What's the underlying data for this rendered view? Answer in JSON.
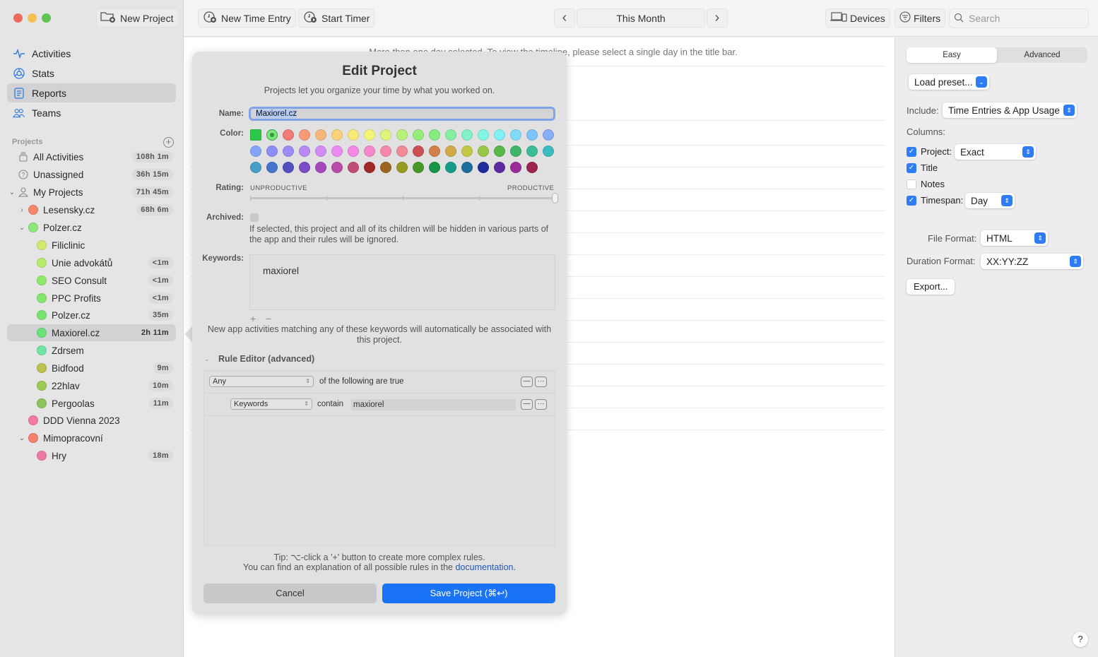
{
  "window": {
    "new_project_label": "New Project"
  },
  "sidebar": {
    "nav": [
      {
        "label": "Activities",
        "icon": "activity-pulse-icon"
      },
      {
        "label": "Stats",
        "icon": "stats-icon"
      },
      {
        "label": "Reports",
        "icon": "report-icon",
        "active": true
      },
      {
        "label": "Teams",
        "icon": "teams-icon"
      }
    ],
    "projects_header": "Projects",
    "add_project_icon": "+",
    "projects": [
      {
        "label": "All Activities",
        "badge": "108h 1m"
      },
      {
        "label": "Unassigned",
        "badge": "36h 15m"
      },
      {
        "label": "My Projects",
        "badge": "71h 45m"
      },
      {
        "label": "Lesensky.cz",
        "badge": "68h 6m",
        "color": "#f5876a"
      },
      {
        "label": "Polzer.cz",
        "badge": "",
        "color": "#8de87a"
      },
      {
        "label": "Filiclinic",
        "badge": "",
        "color": "#d2ea6e"
      },
      {
        "label": "Unie advokátů",
        "badge": "<1m",
        "color": "#b6ec6c"
      },
      {
        "label": "SEO Consult",
        "badge": "<1m",
        "color": "#8eea6a"
      },
      {
        "label": "PPC Profits",
        "badge": "<1m",
        "color": "#84e66e"
      },
      {
        "label": "Polzer.cz",
        "badge": "35m",
        "color": "#78e470"
      },
      {
        "label": "Maxiorel.cz",
        "badge": "2h 11m",
        "color": "#6be27a"
      },
      {
        "label": "Zdrsem",
        "badge": "",
        "color": "#6ee6a2"
      },
      {
        "label": "Bidfood",
        "badge": "9m",
        "color": "#bcc24c"
      },
      {
        "label": "22hlav",
        "badge": "10m",
        "color": "#9ccc52"
      },
      {
        "label": "Pergoolas",
        "badge": "11m",
        "color": "#8dc45e"
      },
      {
        "label": "DDD Vienna 2023",
        "badge": "",
        "color": "#f47aa4"
      },
      {
        "label": "Mimopracovní",
        "badge": "",
        "color": "#f5806e"
      },
      {
        "label": "Hry",
        "badge": "18m",
        "color": "#ee78a6"
      }
    ]
  },
  "toolbar": {
    "new_time_entry": "New Time Entry",
    "start_timer": "Start Timer",
    "period": "This Month",
    "prev_icon": "‹",
    "next_icon": "›",
    "devices": "Devices",
    "filters": "Filters",
    "search_placeholder": "Search"
  },
  "main": {
    "message": "More than one day selected. To view the timeline, please select a single day in the title bar."
  },
  "right_panel": {
    "tabs": [
      "Easy",
      "Advanced"
    ],
    "active_tab": "Easy",
    "load_preset": "Load preset...",
    "include_label": "Include:",
    "include_value": "Time Entries & App Usage",
    "columns_label": "Columns:",
    "columns": [
      {
        "label": "Project:",
        "checked": true,
        "select": "Exact"
      },
      {
        "label": "Title",
        "checked": true
      },
      {
        "label": "Notes",
        "checked": false
      },
      {
        "label": "Timespan:",
        "checked": true,
        "select": "Day"
      }
    ],
    "file_format_label": "File Format:",
    "file_format_value": "HTML",
    "duration_format_label": "Duration Format:",
    "duration_format_value": "XX:YY:ZZ",
    "export_label": "Export...",
    "help_label": "?"
  },
  "dialog": {
    "title": "Edit Project",
    "subtitle": "Projects let you organize your time by what you worked on.",
    "name_label": "Name:",
    "name_value": "Maxiorel.cz",
    "color_label": "Color:",
    "colors": [
      [
        "#2bc94a",
        "#7ee57b",
        "#f47a76",
        "#f89a78",
        "#f8b67c",
        "#fbd27a",
        "#fbe97a",
        "#f4f578",
        "#dcf57a",
        "#b6f27a",
        "#96ee7a",
        "#86ec80",
        "#84efa0",
        "#82f2c8",
        "#82f6e4",
        "#82f0f6",
        "#80dafa",
        "#7ec4fa",
        "#86aef4"
      ],
      [
        "#84a4f8",
        "#8a8ef6",
        "#9e8af6",
        "#b88af6",
        "#d48af6",
        "#ec8af4",
        "#f688e8",
        "#f488cc",
        "#f488ac",
        "#f48a98",
        "#cc5050",
        "#d08048",
        "#d0aa48",
        "#c4c844",
        "#98c846",
        "#58b848",
        "#40b468",
        "#3cbc96",
        "#3cbcc0"
      ],
      [
        "#449ec8",
        "#4474cc",
        "#5450c0",
        "#7c4cc6",
        "#a648be",
        "#b84ca6",
        "#c04c78",
        "#a02828",
        "#9c6420",
        "#969a20",
        "#489828",
        "#169448",
        "#169c88",
        "#1c6c9c",
        "#202c9c",
        "#5c2c9c",
        "#9a2c9a",
        "#9c2450"
      ]
    ],
    "selected_color_index": [
      0,
      1
    ],
    "rating_label": "Rating:",
    "rating_low": "UNPRODUCTIVE",
    "rating_high": "PRODUCTIVE",
    "rating_value": 1.0,
    "archived_label": "Archived:",
    "archived_checked": false,
    "archived_note": "If selected, this project and all of its children will be hidden in various parts of the app and their rules will be ignored.",
    "keywords_label": "Keywords:",
    "keywords": [
      "maxiorel"
    ],
    "kw_add": "+",
    "kw_remove": "−",
    "keywords_note": "New app activities matching any of these keywords will automatically be associated with this project.",
    "rule_editor_title": "Rule Editor (advanced)",
    "rules": {
      "match_select": "Any",
      "match_text": "of the following are true",
      "conditions": [
        {
          "field": "Keywords",
          "operator": "contain",
          "value": "maxiorel"
        }
      ]
    },
    "tip_line1": "Tip: ⌥-click a '+' button to create more complex rules.",
    "tip_line2": "You can find an explanation of all possible rules in the",
    "doc_link": "documentation.",
    "cancel": "Cancel",
    "save": "Save Project (⌘↩)"
  }
}
